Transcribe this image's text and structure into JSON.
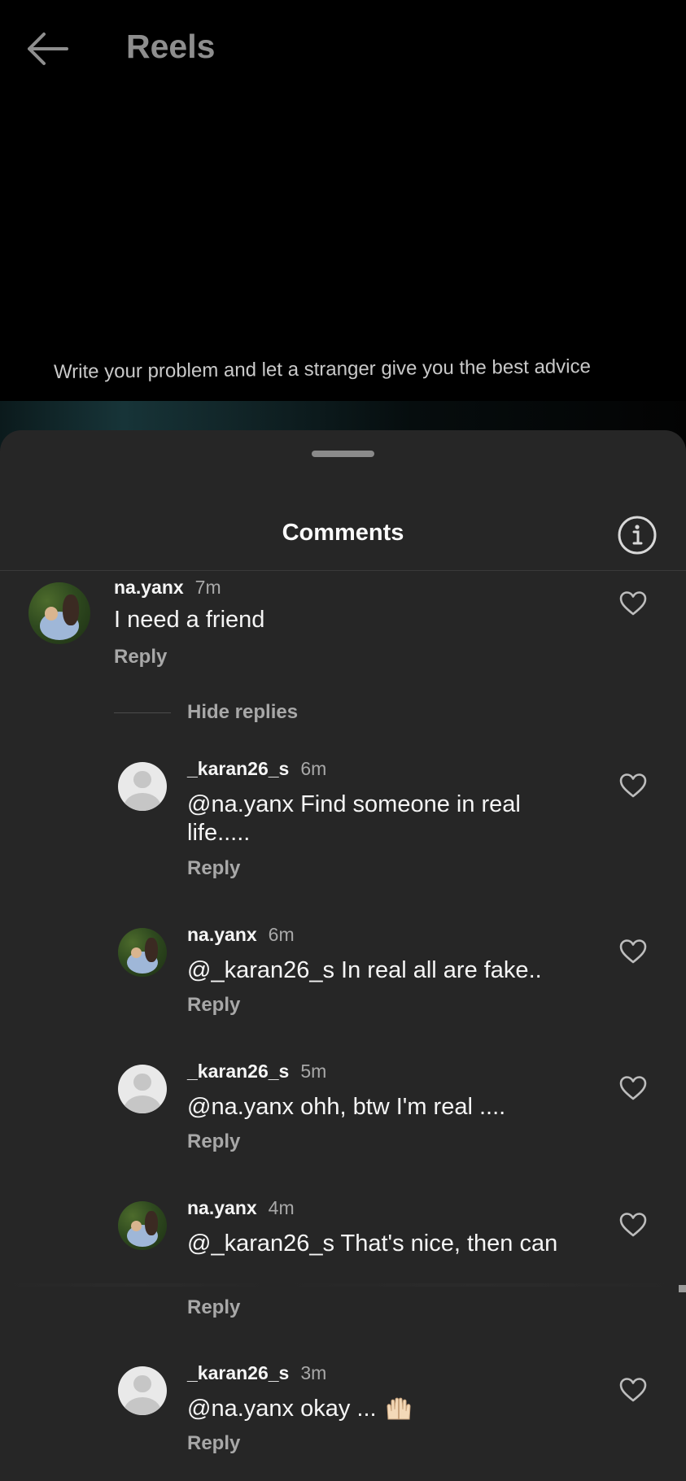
{
  "header": {
    "title": "Reels",
    "back_icon": "arrow-left-icon"
  },
  "reel": {
    "caption": "Write your problem and let a stranger give you the best advice"
  },
  "sheet": {
    "title": "Comments",
    "info_icon": "info-icon"
  },
  "comments": [
    {
      "user": "na.yanx",
      "time": "7m",
      "text": "I need a friend",
      "reply": "Reply"
    }
  ],
  "thread": {
    "hide_label": "Hide replies",
    "replies": [
      {
        "user": "_karan26_s",
        "time": "6m",
        "text": "@na.yanx Find someone in real life.....",
        "reply": "Reply"
      },
      {
        "user": "na.yanx",
        "time": "6m",
        "text": "@_karan26_s In real all are fake..",
        "reply": "Reply"
      },
      {
        "user": "_karan26_s",
        "time": "5m",
        "text": "@na.yanx ohh, btw I'm real ....",
        "reply": "Reply"
      },
      {
        "user": "na.yanx",
        "time": "4m",
        "text": "@_karan26_s That's nice, then can",
        "reply": "Reply"
      },
      {
        "user": "_karan26_s",
        "time": "3m",
        "text": "@na.yanx okay ... ",
        "emoji": "raising-hands-emoji",
        "reply": "Reply"
      }
    ]
  },
  "colors": {
    "sheet_bg": "#262626",
    "secondary_text": "#a8a8a8",
    "primary_text": "#f5f5f5"
  }
}
